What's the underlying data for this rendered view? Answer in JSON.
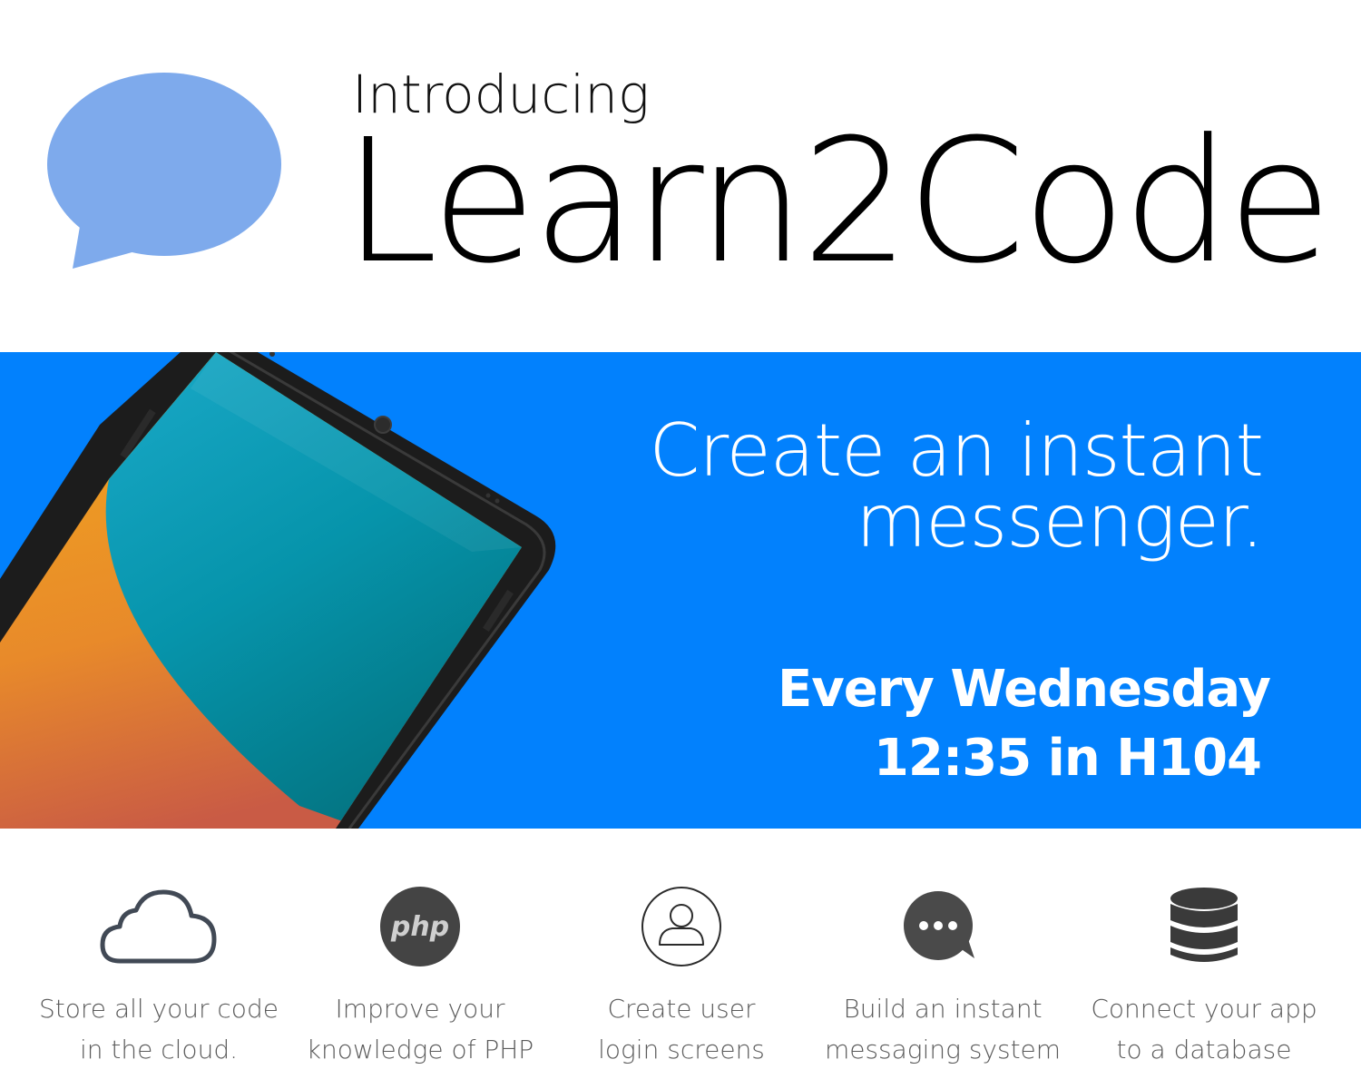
{
  "header": {
    "intro": "Introducing",
    "title": "Learn2Code",
    "logo_icon": "speech-bubble-icon",
    "logo_color": "#7eaaec"
  },
  "banner": {
    "background": "#0281fd",
    "tagline": [
      "Create an instant",
      "messenger."
    ],
    "schedule": [
      "Every Wednesday",
      "12:35 in H104"
    ],
    "image": "android-phone-illustration"
  },
  "features": [
    {
      "icon": "cloud-icon",
      "lines": [
        "Store all your code",
        "in the cloud."
      ]
    },
    {
      "icon": "php-icon",
      "icon_text": "php",
      "lines": [
        "Improve your",
        "knowledge of PHP"
      ]
    },
    {
      "icon": "user-icon",
      "lines": [
        "Create user",
        "login screens"
      ]
    },
    {
      "icon": "chat-bubble-icon",
      "lines": [
        "Build an instant",
        "messaging system"
      ]
    },
    {
      "icon": "database-icon",
      "lines": [
        "Connect your app",
        "to a database"
      ]
    }
  ]
}
